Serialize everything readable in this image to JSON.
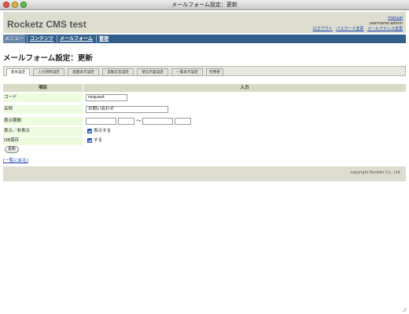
{
  "window": {
    "title": "メールフォーム設定：更新"
  },
  "header": {
    "site_name": "Rocketz CMS test",
    "manual_link": "manual",
    "username": "username:admin",
    "links": [
      "ログアウト",
      "パスワード変更",
      "メールアドレス変更"
    ]
  },
  "nav": [
    "メニュー",
    "コンテンツ",
    "メールフォーム",
    "管理"
  ],
  "page_title": "メールフォーム設定：更新",
  "tabs": [
    "基本設定",
    "入力項目設定",
    "画面表示設定",
    "自動応答設定",
    "受信内容設定",
    "一覧表示設定",
    "利用者"
  ],
  "active_tab": "基本設定",
  "table": {
    "header_item": "項目",
    "header_input": "入力",
    "rows": {
      "code": {
        "label": "コード",
        "value": "request"
      },
      "name": {
        "label": "名称",
        "value": "お問い合わせ"
      },
      "period": {
        "label": "表示期間",
        "separator": "〜"
      },
      "visible": {
        "label": "表示／非表示",
        "checkbox_label": "表示する",
        "checked": true
      },
      "db": {
        "label": "DB保存",
        "checkbox_label": "する",
        "checked": true
      }
    }
  },
  "update_button": "更新",
  "back_link": "[一覧に戻る]",
  "footer": {
    "copyright": "copyright Rocketz Co., Ltd."
  },
  "colors": {
    "nav_bg": "#335f8c",
    "header_bg": "#dcdccf",
    "label_bg": "#edfbdf",
    "table_header_bg": "#d7dcc4",
    "link": "#1a3fb0"
  }
}
